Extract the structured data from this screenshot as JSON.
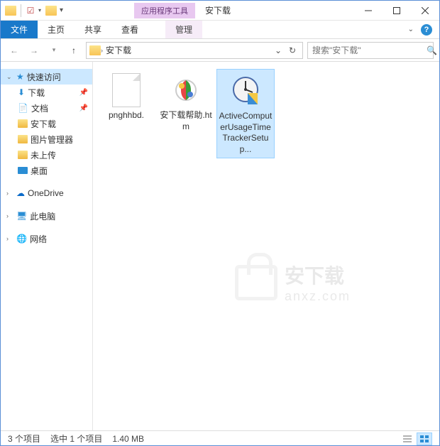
{
  "titlebar": {
    "context_tab": "应用程序工具",
    "window_title": "安下载"
  },
  "ribbon": {
    "file": "文件",
    "tabs": [
      "主页",
      "共享",
      "查看"
    ],
    "context_tab": "管理"
  },
  "address": {
    "crumb": "安下载",
    "search_placeholder": "搜索\"安下载\""
  },
  "sidebar": {
    "quick_access": "快速访问",
    "items": [
      {
        "label": "下载",
        "icon": "download",
        "pinned": true
      },
      {
        "label": "文档",
        "icon": "document",
        "pinned": true
      },
      {
        "label": "安下载",
        "icon": "folder",
        "pinned": false
      },
      {
        "label": "图片管理器",
        "icon": "folder",
        "pinned": false
      },
      {
        "label": "未上传",
        "icon": "folder",
        "pinned": false
      },
      {
        "label": "桌面",
        "icon": "desktop",
        "pinned": false
      }
    ],
    "onedrive": "OneDrive",
    "this_pc": "此电脑",
    "network": "网络"
  },
  "files": [
    {
      "name": "pnghhbd.",
      "type": "blank"
    },
    {
      "name": "安下载帮助.htm",
      "type": "htm"
    },
    {
      "name": "ActiveComputerUsageTimeTrackerSetup...",
      "type": "exe",
      "selected": true
    }
  ],
  "watermark": {
    "text": "安下载",
    "sub": "anxz.com"
  },
  "status": {
    "count": "3 个项目",
    "selection": "选中 1 个项目",
    "size": "1.40 MB"
  }
}
